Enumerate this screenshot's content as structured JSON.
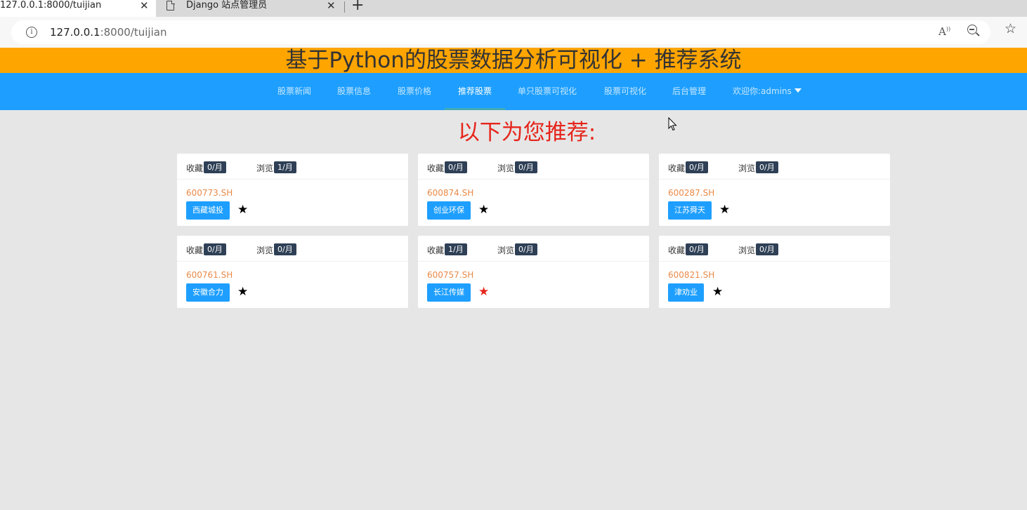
{
  "browser": {
    "tabs": [
      {
        "title": "127.0.0.1:8000/tuijian",
        "close": "✕"
      },
      {
        "title": "Django 站点管理员",
        "close": "✕"
      }
    ],
    "new_tab": "+",
    "url_host": "127.0.0.1",
    "url_rest": ":8000/tuijian",
    "info_icon": "i",
    "read_aloud_icon": "Á"
  },
  "site_title": "基于Python的股票数据分析可视化 + 推荐系统",
  "nav": [
    {
      "label": "股票新闻"
    },
    {
      "label": "股票信息"
    },
    {
      "label": "股票价格"
    },
    {
      "label": "推荐股票",
      "active": true
    },
    {
      "label": "单只股票可视化"
    },
    {
      "label": "股票可视化"
    },
    {
      "label": "后台管理"
    },
    {
      "label": "欢迎你:admins"
    }
  ],
  "heading": "以下为您推荐:",
  "cards": [
    {
      "fav_label": "收藏",
      "fav_count": "0/月",
      "view_label": "浏览",
      "view_count": "1/月",
      "code": "600773.SH",
      "name": "西藏城投",
      "starred": false
    },
    {
      "fav_label": "收藏",
      "fav_count": "0/月",
      "view_label": "浏览",
      "view_count": "0/月",
      "code": "600874.SH",
      "name": "创业环保",
      "starred": false
    },
    {
      "fav_label": "收藏",
      "fav_count": "0/月",
      "view_label": "浏览",
      "view_count": "0/月",
      "code": "600287.SH",
      "name": "江苏舜天",
      "starred": false
    },
    {
      "fav_label": "收藏",
      "fav_count": "0/月",
      "view_label": "浏览",
      "view_count": "0/月",
      "code": "600761.SH",
      "name": "安徽合力",
      "starred": false
    },
    {
      "fav_label": "收藏",
      "fav_count": "1/月",
      "view_label": "浏览",
      "view_count": "0/月",
      "code": "600757.SH",
      "name": "长江传媒",
      "starred": true
    },
    {
      "fav_label": "收藏",
      "fav_count": "0/月",
      "view_label": "浏览",
      "view_count": "0/月",
      "code": "600821.SH",
      "name": "津劝业",
      "starred": false
    }
  ],
  "star_glyph": "★",
  "colors": {
    "title_bar": "#ffa500",
    "nav_bar": "#1e9fff",
    "heading": "#e6251b",
    "code": "#e98a47",
    "badge": "#2f4056",
    "star_default": "#000000",
    "star_active": "#e6251b"
  }
}
